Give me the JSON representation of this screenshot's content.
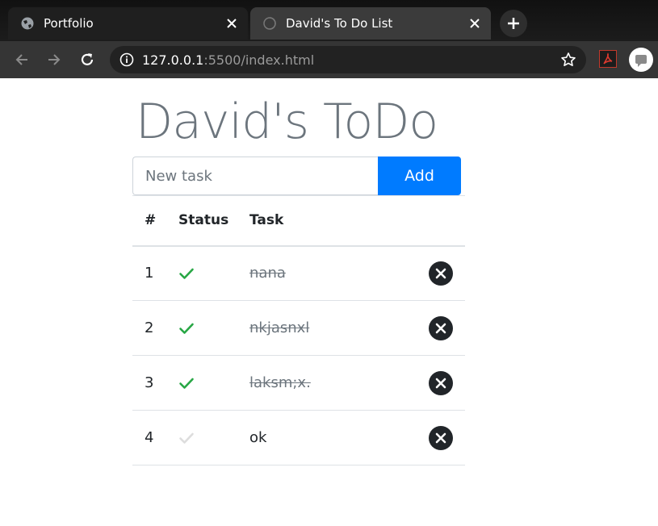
{
  "browser": {
    "tabs": [
      {
        "title": "Portfolio",
        "active": false
      },
      {
        "title": "David's To Do List",
        "active": true
      }
    ],
    "url": {
      "host": "127.0.0.1",
      "rest": ":5500/index.html"
    },
    "icons": [
      "globe-icon",
      "close-icon",
      "plus-icon",
      "back-arrow-icon",
      "forward-arrow-icon",
      "reload-icon",
      "info-icon",
      "star-icon",
      "pdf-icon",
      "profile-icon"
    ]
  },
  "app": {
    "title": "David's ToDo",
    "input": {
      "placeholder": "New task",
      "value": ""
    },
    "add_label": "Add",
    "table": {
      "headers": {
        "num": "#",
        "status": "Status",
        "task": "Task"
      },
      "rows": [
        {
          "num": "1",
          "task": "nana",
          "completed": true
        },
        {
          "num": "2",
          "task": "nkjasnxl",
          "completed": true
        },
        {
          "num": "3",
          "task": "laksm;x.",
          "completed": true
        },
        {
          "num": "4",
          "task": "ok",
          "completed": false
        }
      ]
    },
    "colors": {
      "accent": "#007bff",
      "check_done": "#28a745",
      "check_pending": "#dddddd",
      "delete_bg": "#212529",
      "heading": "#6c757d"
    }
  }
}
